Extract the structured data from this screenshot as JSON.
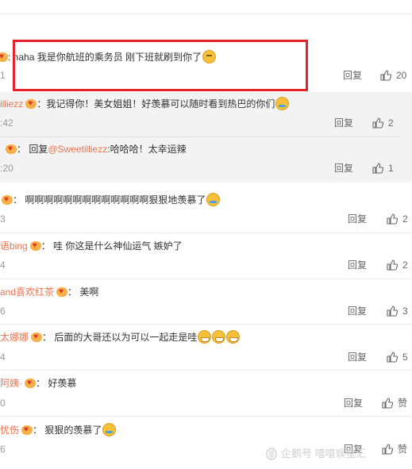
{
  "comments": [
    {
      "name": "",
      "text": "haha 我是你航班的乘务员 刚下班就刷到你了",
      "emoji": "think",
      "time": "1",
      "reply": "回复",
      "likes": "20"
    },
    {
      "name": "illiezz",
      "text": "我记得你！美女姐姐！好羡慕可以随时看到热巴的你们",
      "emoji": "cry",
      "time": ":42",
      "reply": "回复",
      "likes": "2"
    },
    {
      "name": "",
      "reply_prefix": "回复",
      "mention": "@Sweetilliezz",
      "text": ":哈哈哈！太幸运辣",
      "emoji": "",
      "time": ":20",
      "reply": "回复",
      "likes": "1"
    },
    {
      "name": "",
      "text": "啊啊啊啊啊啊啊啊啊啊啊啊啊狠狠地羡慕了",
      "emoji": "cry",
      "time": "3",
      "reply": "回复",
      "likes": "2"
    },
    {
      "name": "语bing",
      "text": "哇 你这是什么神仙运气 嫉妒了",
      "emoji": "",
      "time": "4",
      "reply": "回复",
      "likes": "2"
    },
    {
      "name": "and喜欢红茶",
      "text": "美啊",
      "emoji": "",
      "time": "6",
      "reply": "回复",
      "likes": "3"
    },
    {
      "name": "太娜娜",
      "text": "后面的大哥还以为可以一起走是哇",
      "emoji": "grin3",
      "time": "4",
      "reply": "回复",
      "likes": "5"
    },
    {
      "name": "阿姨·",
      "text": "好羡慕",
      "emoji": "",
      "time": "0",
      "reply": "回复",
      "likes": "赞"
    },
    {
      "name": "忧伤",
      "text": "狠狠的羡慕了",
      "emoji": "cry",
      "time": "6",
      "reply": "回复",
      "likes": "赞"
    }
  ],
  "watermark": "企鹅号 嘻嘻娱星汇",
  "colors": {
    "accent": "#eb7350",
    "highlight_box": "#e4232b",
    "sub_bg": "#f3f3f3"
  },
  "icons": [
    "vip-badge-icon",
    "thumb-up-icon",
    "emoji-icon",
    "penguin-icon"
  ]
}
